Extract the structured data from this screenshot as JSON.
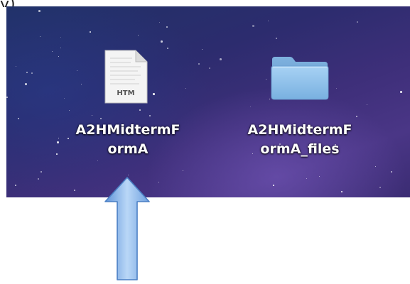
{
  "desktop": {
    "items": [
      {
        "label_line1": "A2HMidtermF",
        "label_line2": "ormA",
        "icon": "htm-file-icon",
        "icon_badge": "HTM"
      },
      {
        "label_line1": "A2HMidtermF",
        "label_line2": "ormA_files",
        "icon": "folder-icon"
      }
    ]
  },
  "annotation": {
    "icon": "arrow-up-icon",
    "color": "#7aaee8"
  },
  "colors": {
    "desktop_background": "#2f2f72",
    "label_text": "#ffffff",
    "folder": "#8cc0ea"
  }
}
